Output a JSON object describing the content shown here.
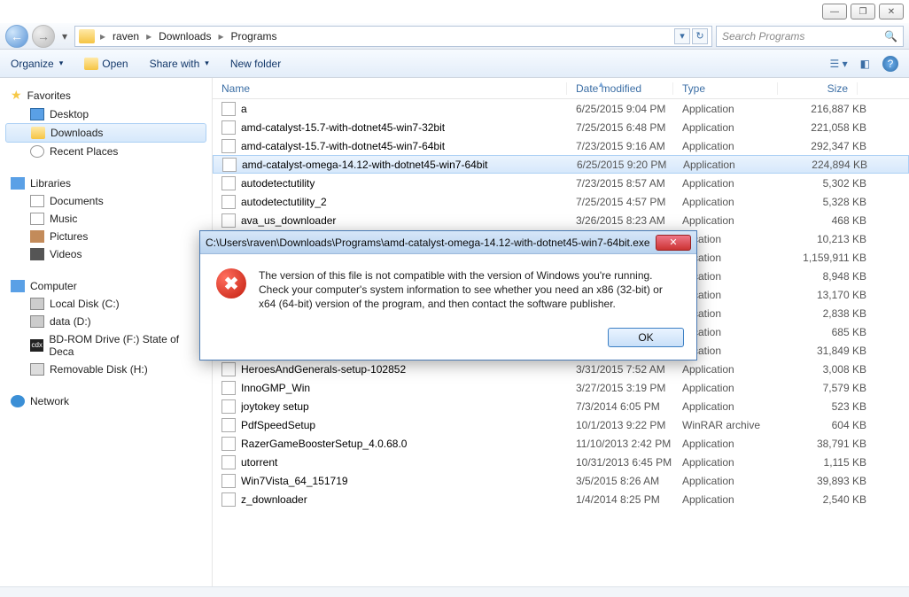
{
  "window_controls": {
    "min": "—",
    "max": "❐",
    "close": "✕"
  },
  "breadcrumbs": {
    "items": [
      "raven",
      "Downloads",
      "Programs"
    ]
  },
  "addr_buttons": {
    "dd": "▾",
    "refresh": "↻"
  },
  "search": {
    "placeholder": "Search Programs"
  },
  "toolbar": {
    "organize": "Organize",
    "open": "Open",
    "share": "Share with",
    "new_folder": "New folder"
  },
  "sidebar": {
    "favorites": {
      "label": "Favorites",
      "items": [
        {
          "label": "Desktop",
          "icon": "mon"
        },
        {
          "label": "Downloads",
          "icon": "folder",
          "selected": true
        },
        {
          "label": "Recent Places",
          "icon": "clock"
        }
      ]
    },
    "libraries": {
      "label": "Libraries",
      "items": [
        {
          "label": "Documents",
          "icon": "doc"
        },
        {
          "label": "Music",
          "icon": "music"
        },
        {
          "label": "Pictures",
          "icon": "pic"
        },
        {
          "label": "Videos",
          "icon": "vid"
        }
      ]
    },
    "computer": {
      "label": "Computer",
      "items": [
        {
          "label": "Local Disk (C:)",
          "icon": "disk"
        },
        {
          "label": "data (D:)",
          "icon": "disk"
        },
        {
          "label": "BD-ROM Drive (F:) State of Deca",
          "icon": "cdx"
        },
        {
          "label": "Removable Disk (H:)",
          "icon": "usb"
        }
      ]
    },
    "network": {
      "label": "Network"
    }
  },
  "columns": {
    "name": "Name",
    "date": "Date modified",
    "type": "Type",
    "size": "Size"
  },
  "files": [
    {
      "name": "a",
      "date": "6/25/2015 9:04 PM",
      "type": "Application",
      "size": "216,887 KB"
    },
    {
      "name": "amd-catalyst-15.7-with-dotnet45-win7-32bit",
      "date": "7/25/2015 6:48 PM",
      "type": "Application",
      "size": "221,058 KB"
    },
    {
      "name": "amd-catalyst-15.7-with-dotnet45-win7-64bit",
      "date": "7/23/2015 9:16 AM",
      "type": "Application",
      "size": "292,347 KB"
    },
    {
      "name": "amd-catalyst-omega-14.12-with-dotnet45-win7-64bit",
      "date": "6/25/2015 9:20 PM",
      "type": "Application",
      "size": "224,894 KB",
      "selected": true
    },
    {
      "name": "autodetectutility",
      "date": "7/23/2015 8:57 AM",
      "type": "Application",
      "size": "5,302 KB"
    },
    {
      "name": "autodetectutility_2",
      "date": "7/25/2015 4:57 PM",
      "type": "Application",
      "size": "5,328 KB"
    },
    {
      "name": "ava_us_downloader",
      "date": "3/26/2015 8:23 AM",
      "type": "Application",
      "size": "468 KB"
    },
    {
      "name": "",
      "date": "",
      "type": "plication",
      "size": "10,213 KB"
    },
    {
      "name": "",
      "date": "",
      "type": "plication",
      "size": "1,159,911 KB"
    },
    {
      "name": "",
      "date": "",
      "type": "plication",
      "size": "8,948 KB"
    },
    {
      "name": "",
      "date": "",
      "type": "plication",
      "size": "13,170 KB"
    },
    {
      "name": "",
      "date": "",
      "type": "plication",
      "size": "2,838 KB"
    },
    {
      "name": "",
      "date": "",
      "type": "plication",
      "size": "685 KB"
    },
    {
      "name": "",
      "date": "",
      "type": "plication",
      "size": "31,849 KB"
    },
    {
      "name": "HeroesAndGenerals-setup-102852",
      "date": "3/31/2015 7:52 AM",
      "type": "Application",
      "size": "3,008 KB"
    },
    {
      "name": "InnoGMP_Win",
      "date": "3/27/2015 3:19 PM",
      "type": "Application",
      "size": "7,579 KB"
    },
    {
      "name": "joytokey setup",
      "date": "7/3/2014 6:05 PM",
      "type": "Application",
      "size": "523 KB"
    },
    {
      "name": "PdfSpeedSetup",
      "date": "10/1/2013 9:22 PM",
      "type": "WinRAR archive",
      "size": "604 KB"
    },
    {
      "name": "RazerGameBoosterSetup_4.0.68.0",
      "date": "11/10/2013 2:42 PM",
      "type": "Application",
      "size": "38,791 KB"
    },
    {
      "name": "utorrent",
      "date": "10/31/2013 6:45 PM",
      "type": "Application",
      "size": "1,115 KB"
    },
    {
      "name": "Win7Vista_64_151719",
      "date": "3/5/2015 8:26 AM",
      "type": "Application",
      "size": "39,893 KB"
    },
    {
      "name": "z_downloader",
      "date": "1/4/2014 8:25 PM",
      "type": "Application",
      "size": "2,540 KB"
    }
  ],
  "dialog": {
    "title": "C:\\Users\\raven\\Downloads\\Programs\\amd-catalyst-omega-14.12-with-dotnet45-win7-64bit.exe",
    "message": "The version of this file is not compatible with the version of Windows you're running. Check your computer's system information to see whether you need an x86 (32-bit) or x64 (64-bit) version of the program, and then contact the software publisher.",
    "ok": "OK"
  }
}
